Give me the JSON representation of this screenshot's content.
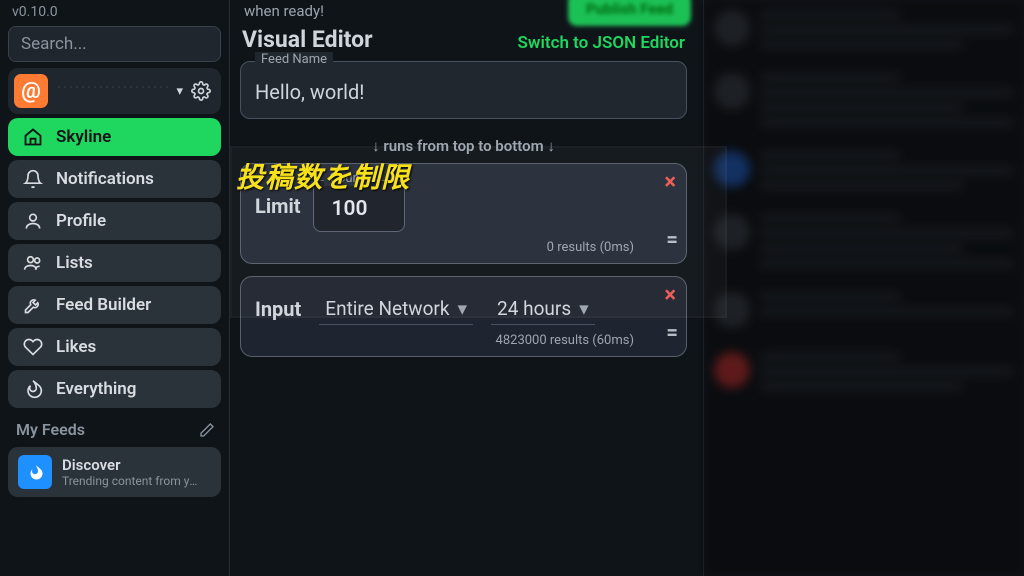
{
  "version": "v0.10.0",
  "search_placeholder": "Search...",
  "sidebar": {
    "items": [
      {
        "label": "Skyline"
      },
      {
        "label": "Notifications"
      },
      {
        "label": "Profile"
      },
      {
        "label": "Lists"
      },
      {
        "label": "Feed Builder"
      },
      {
        "label": "Likes"
      },
      {
        "label": "Everything"
      }
    ]
  },
  "feeds": {
    "header": "My Feeds",
    "discover": {
      "title": "Discover",
      "subtitle": "Trending content from yo..."
    }
  },
  "main": {
    "intro": "when ready!",
    "ve_title": "Visual Editor",
    "switch_link": "Switch to JSON Editor",
    "feed_name_label": "Feed Name",
    "feed_name_value": "Hello, world!",
    "pipeline_header": "↓ runs from top to bottom ↓"
  },
  "blocks": {
    "limit": {
      "label": "Limit",
      "count_label": "Count",
      "count_value": "100",
      "footer": "0 results (0ms)"
    },
    "input": {
      "label": "Input",
      "source": "Entire Network",
      "window": "24 hours",
      "footer": "4823000 results (60ms)"
    }
  },
  "annotation": "投稿数を制限"
}
